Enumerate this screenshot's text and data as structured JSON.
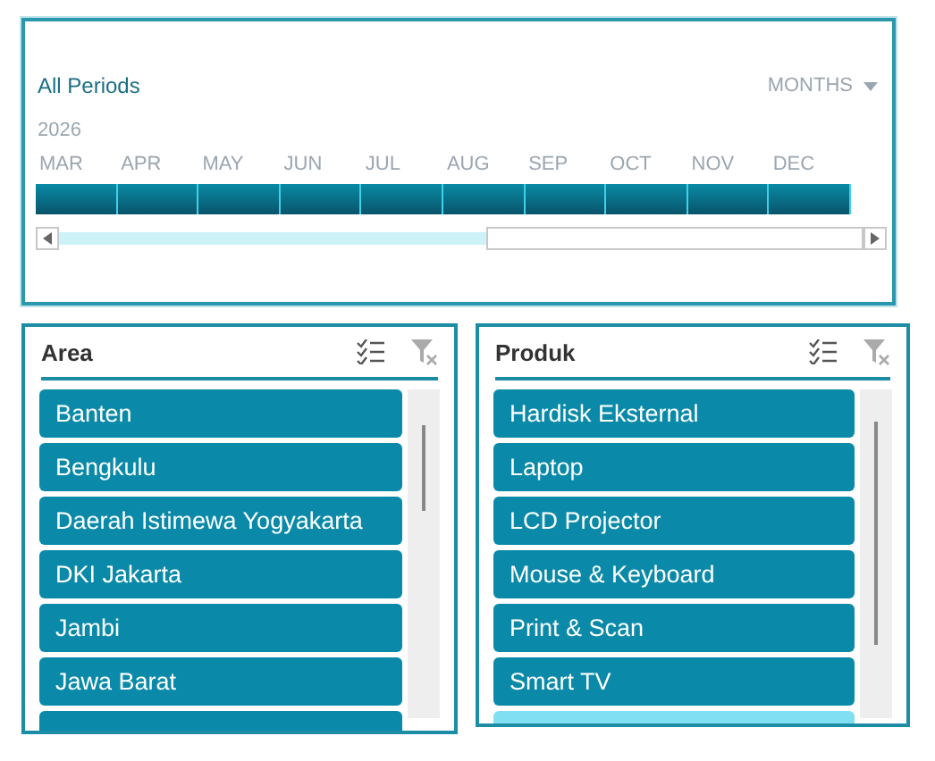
{
  "timeline": {
    "caption": "All Periods",
    "level_label": "MONTHS",
    "year": "2026",
    "months": [
      {
        "label": "MAR",
        "selected": true
      },
      {
        "label": "APR",
        "selected": true
      },
      {
        "label": "MAY",
        "selected": true
      },
      {
        "label": "JUN",
        "selected": true
      },
      {
        "label": "JUL",
        "selected": true
      },
      {
        "label": "AUG",
        "selected": true
      },
      {
        "label": "SEP",
        "selected": true
      },
      {
        "label": "OCT",
        "selected": true
      },
      {
        "label": "NOV",
        "selected": true
      },
      {
        "label": "DEC",
        "selected": true
      }
    ]
  },
  "slicers": [
    {
      "title": "Area",
      "items": [
        {
          "label": "Banten",
          "selected": true
        },
        {
          "label": "Bengkulu",
          "selected": true
        },
        {
          "label": "Daerah Istimewa Yogyakarta",
          "selected": true
        },
        {
          "label": "DKI Jakarta",
          "selected": true
        },
        {
          "label": "Jambi",
          "selected": true
        },
        {
          "label": "Jawa Barat",
          "selected": true
        },
        {
          "selected": true
        }
      ]
    },
    {
      "title": "Produk",
      "items": [
        {
          "label": "Hardisk Eksternal",
          "selected": true
        },
        {
          "label": "Laptop",
          "selected": true
        },
        {
          "label": "LCD Projector",
          "selected": true
        },
        {
          "label": "Mouse & Keyboard",
          "selected": true
        },
        {
          "label": "Print & Scan",
          "selected": true
        },
        {
          "label": "Smart TV",
          "selected": true
        },
        {
          "selected": false
        }
      ]
    }
  ]
}
